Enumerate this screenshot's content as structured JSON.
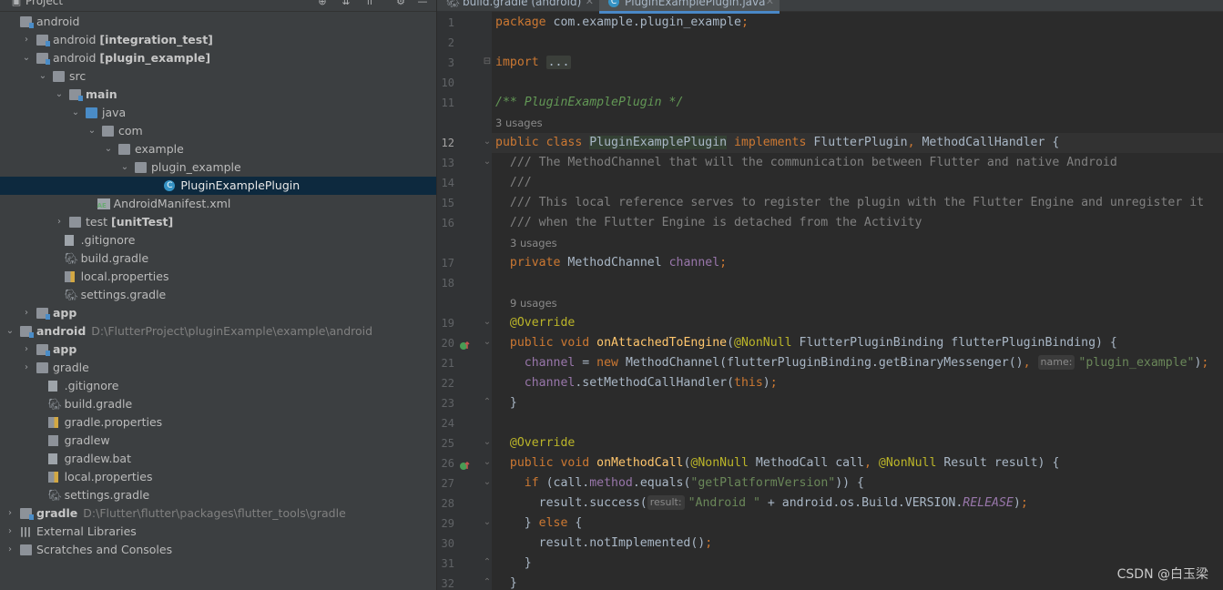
{
  "project_panel": {
    "title": "Project",
    "tree": [
      {
        "label": "android",
        "bold": "",
        "path": ""
      },
      {
        "label": "android ",
        "bold": "[integration_test]",
        "path": ""
      },
      {
        "label": "android ",
        "bold": "[plugin_example]",
        "path": ""
      },
      {
        "label": "src",
        "bold": "",
        "path": ""
      },
      {
        "label": "",
        "bold": "main",
        "path": ""
      },
      {
        "label": "java",
        "bold": "",
        "path": ""
      },
      {
        "label": "com",
        "bold": "",
        "path": ""
      },
      {
        "label": "example",
        "bold": "",
        "path": ""
      },
      {
        "label": "plugin_example",
        "bold": "",
        "path": ""
      },
      {
        "label": "PluginExamplePlugin",
        "bold": "",
        "path": ""
      },
      {
        "label": "AndroidManifest.xml",
        "bold": "",
        "path": ""
      },
      {
        "label": "test ",
        "bold": "[unitTest]",
        "path": ""
      },
      {
        "label": ".gitignore",
        "bold": "",
        "path": ""
      },
      {
        "label": "build.gradle",
        "bold": "",
        "path": ""
      },
      {
        "label": "local.properties",
        "bold": "",
        "path": ""
      },
      {
        "label": "settings.gradle",
        "bold": "",
        "path": ""
      },
      {
        "label": "",
        "bold": "app",
        "path": ""
      },
      {
        "label": "",
        "bold": "android",
        "path": "D:\\FlutterProject\\pluginExample\\example\\android"
      },
      {
        "label": "",
        "bold": "app",
        "path": ""
      },
      {
        "label": "gradle",
        "bold": "",
        "path": ""
      },
      {
        "label": ".gitignore",
        "bold": "",
        "path": ""
      },
      {
        "label": "build.gradle",
        "bold": "",
        "path": ""
      },
      {
        "label": "gradle.properties",
        "bold": "",
        "path": ""
      },
      {
        "label": "gradlew",
        "bold": "",
        "path": ""
      },
      {
        "label": "gradlew.bat",
        "bold": "",
        "path": ""
      },
      {
        "label": "local.properties",
        "bold": "",
        "path": ""
      },
      {
        "label": "settings.gradle",
        "bold": "",
        "path": ""
      },
      {
        "label": "",
        "bold": "gradle",
        "path": "D:\\Flutter\\flutter\\packages\\flutter_tools\\gradle"
      },
      {
        "label": "External Libraries",
        "bold": "",
        "path": ""
      },
      {
        "label": "Scratches and Consoles",
        "bold": "",
        "path": ""
      }
    ]
  },
  "tabs": [
    {
      "label": "build.gradle (android)",
      "active": false
    },
    {
      "label": "PluginExamplePlugin.java",
      "active": true
    }
  ],
  "editor": {
    "line_numbers": [
      "1",
      "2",
      "3",
      "10",
      "11",
      "12",
      "13",
      "14",
      "15",
      "16",
      "17",
      "18",
      "19",
      "20",
      "21",
      "22",
      "23",
      "24",
      "25",
      "26",
      "27",
      "28",
      "29",
      "30",
      "31",
      "32"
    ],
    "usage_hints": [
      "3 usages",
      "3 usages",
      "9 usages"
    ],
    "parameter_hints": [
      "name:",
      "result:"
    ],
    "code": {
      "package_kw": "package",
      "package_name": " com.example.plugin_example;",
      "import_kw": "import",
      "import_dots": "...",
      "class_doc": "/** PluginExamplePlugin */",
      "comment1": "/// The MethodChannel that will the communication between Flutter and native Android",
      "comment2": "///",
      "comment3": "/// This local reference serves to register the plugin with the Flutter Engine and unregister it",
      "comment4": "/// when the Flutter Engine is detached from the Activity",
      "channel_name": "\"plugin_example\"",
      "method_name": "\"getPlatformVersion\"",
      "android_str": "\"Android \""
    }
  },
  "watermark": "CSDN @白玉梁",
  "colors": {
    "keyword": "#cc7832",
    "string": "#6a8759",
    "annotation": "#bbb529",
    "method": "#ffc66d",
    "field": "#9876aa",
    "doc": "#629755"
  }
}
